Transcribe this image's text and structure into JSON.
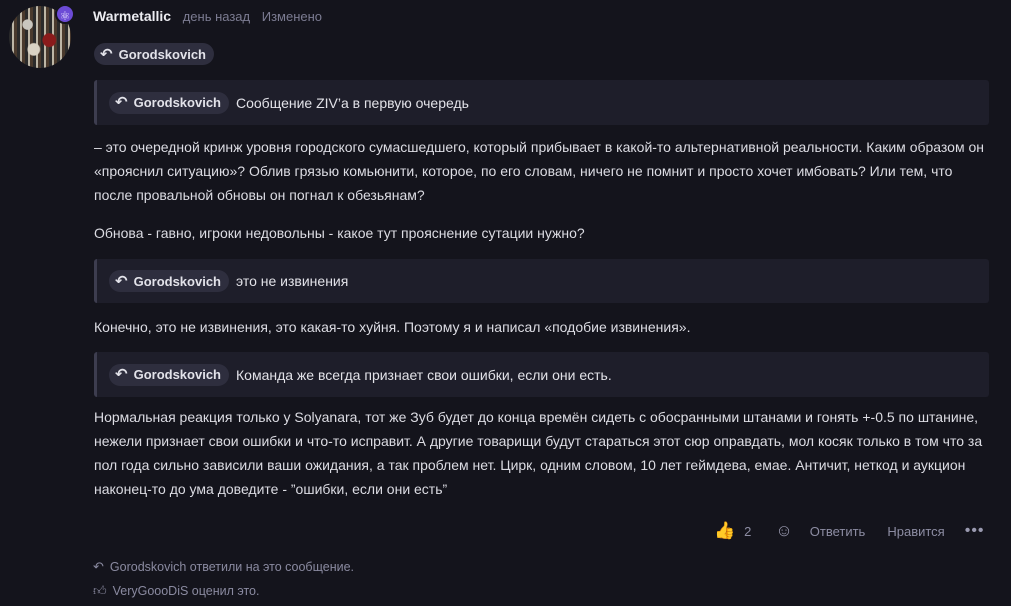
{
  "post": {
    "author": "Warmetallic",
    "time": "день назад",
    "edited": "Изменено",
    "avatar_badge_icon": "atom-icon",
    "reply_to": "Gorodskovich"
  },
  "quotes": [
    {
      "author": "Gorodskovich",
      "text": "Сообщение ZIV’a в первую очередь"
    },
    {
      "author": "Gorodskovich",
      "text": "это не извинения"
    },
    {
      "author": "Gorodskovich",
      "text": "Команда же всегда признает свои ошибки, если они есть."
    }
  ],
  "paragraphs": [
    "– это очередной кринж уровня городского сумасшедшего, который прибывает в какой-то альтернативной реальности. Каким образом он «прояснил ситуацию»? Облив грязью комьюнити, которое, по его словам, ничего не помнит и просто хочет имбовать? Или тем, что после провальной обновы он погнал к обезьянам?",
    "Обнова - гавно, игроки недовольны - какое тут прояснение сутации нужно?",
    "Конечно, это не извинения, это какая-то хуйня. Поэтому я и написал «подобие извинения».",
    "Нормальная реакция только у Solyanara, тот же Зуб будет до конца времён сидеть с обосранными штанами и гонять +-0.5 по штанине, нежели признает свои ошибки и что-то исправит. А другие товарищи будут стараться этот сюр оправдать, мол косяк только в том что за пол года сильно зависили ваши ожидания, а так проблем нет. Цирк, одним словом, 10 лет геймдева, емае. Античит, неткод и аукцион наконец-то до ума доведите - ”ошибки, если они есть”"
  ],
  "actions": {
    "like_count": "2",
    "reply_label": "Ответить",
    "like_label": "Нравится"
  },
  "notices": {
    "replied": "Gorodskovich ответили на это сообщение.",
    "liked": "VeryGoooDiS оценил это."
  }
}
